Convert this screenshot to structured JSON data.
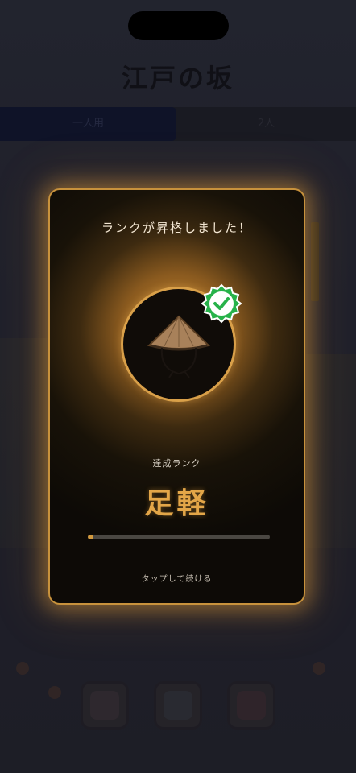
{
  "app": {
    "title": "江戸の坂"
  },
  "tabs": [
    {
      "label": "一人用"
    },
    {
      "label": "2人"
    }
  ],
  "modal": {
    "title": "ランクが昇格しました！",
    "rank_label": "達成ランク",
    "rank_name": "足軽",
    "progress": 0.03,
    "tap_hint": "タップして続ける",
    "icon": "straw-hat-icon",
    "badge_icon": "check-badge-icon"
  },
  "colors": {
    "accent": "#d39a3e",
    "badge_green": "#27b24a",
    "modal_border": "#c8923c"
  }
}
